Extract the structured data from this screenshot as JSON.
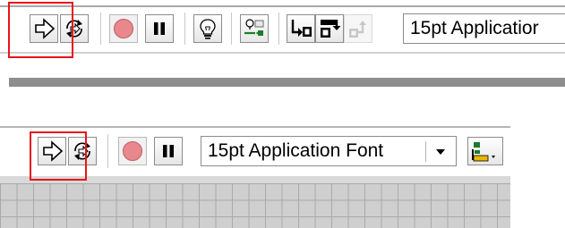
{
  "top_toolbar": {
    "font_selector": {
      "value": "15pt Applicatior"
    },
    "icons": [
      "run-arrow-icon",
      "run-continuously-icon",
      "abort-icon",
      "pause-icon",
      "highlight-execution-icon",
      "retain-wire-values-icon",
      "step-into-icon",
      "step-over-icon",
      "step-out-icon"
    ]
  },
  "bottom_toolbar": {
    "font_selector": {
      "value": "15pt Application Font"
    },
    "icons": [
      "run-arrow-icon",
      "run-continuously-icon",
      "abort-icon",
      "pause-icon",
      "dropdown-arrow-icon",
      "align-objects-icon"
    ]
  },
  "colors": {
    "highlight": "#e8141b",
    "abort_red": "#e8888d",
    "divider": "#8e8e8e",
    "grid_bg": "#cfcfcf"
  }
}
